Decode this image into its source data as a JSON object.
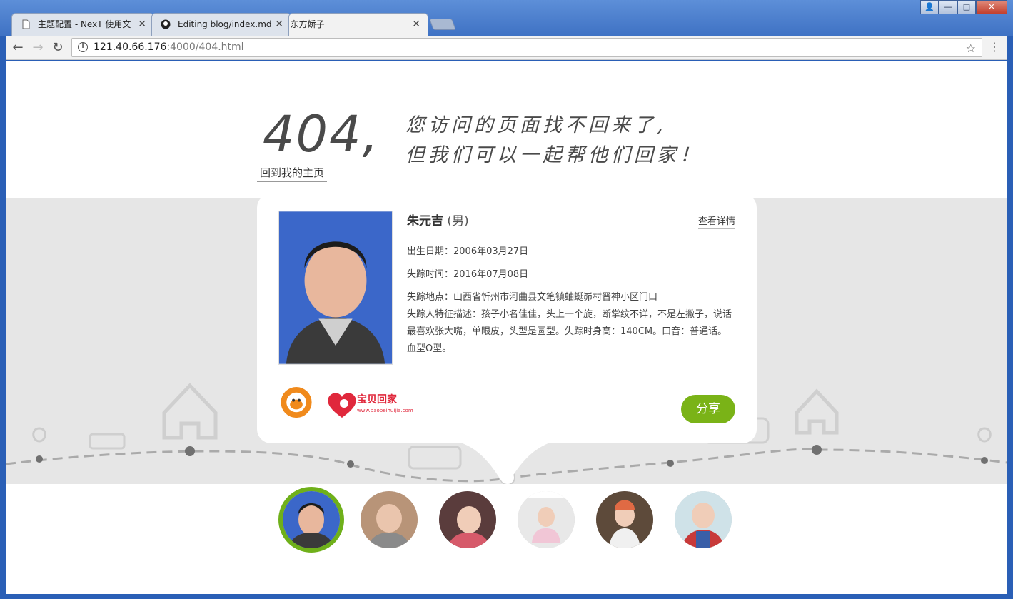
{
  "browser": {
    "tabs": [
      {
        "title": "主题配置 - NexT 使用文"
      },
      {
        "title": "Editing blog/index.md"
      },
      {
        "title": "娇 | 东方娇子"
      }
    ],
    "address": {
      "host": "121.40.66.176",
      "path": ":4000/404.html"
    }
  },
  "page": {
    "code": "404,",
    "message_line1": "您访问的页面找不回来了,",
    "message_line2": "但我们可以一起帮他们回家！",
    "home_link": "回到我的主页"
  },
  "card": {
    "name": "朱元吉",
    "gender": "(男)",
    "detail_link": "查看详情",
    "birth": "出生日期：2006年03月27日",
    "missing_time": "失踪时间：2016年07月08日",
    "missing_place": "失踪地点：山西省忻州市河曲县文笔镇蚰蜒峁村晋神小区门口",
    "description": "失踪人特征描述：孩子小名佳佳，头上一个旋，断掌纹不详，不是左撇子，说话最喜欢张大嘴，单眼皮，头型是圆型。失踪时身高：140CM。口音：普通话。血型O型。",
    "share_label": "分享",
    "logo2_text": "宝贝回家",
    "logo2_url": "www.baobeihuijia.com"
  },
  "thumbnails": [
    {
      "active": true
    },
    {
      "active": false
    },
    {
      "active": false
    },
    {
      "active": false
    },
    {
      "active": false
    },
    {
      "active": false
    }
  ],
  "colors": {
    "accent": "#7ab317",
    "band": "#e6e6e6",
    "text": "#444444"
  }
}
